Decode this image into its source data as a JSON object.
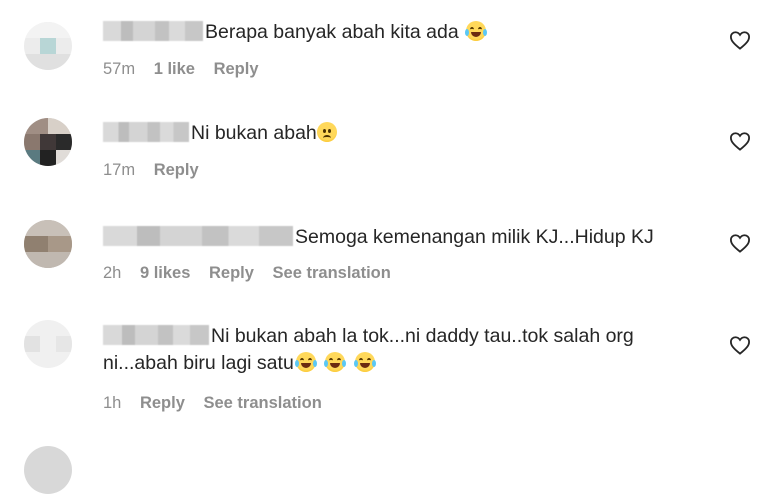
{
  "comments": [
    {
      "text": "Berapa banyak abah kita ada",
      "emoji": "joy-emoji",
      "time": "57m",
      "likes": "1 like",
      "reply": "Reply",
      "translation": ""
    },
    {
      "text": "Ni bukan abah",
      "emoji": "sad-emoji",
      "time": "17m",
      "likes": "",
      "reply": "Reply",
      "translation": ""
    },
    {
      "text": "Semoga kemenangan milik KJ...Hidup KJ",
      "emoji": "",
      "time": "2h",
      "likes": "9 likes",
      "reply": "Reply",
      "translation": "See translation"
    },
    {
      "text_line1": "Ni bukan abah la tok...ni daddy tau..tok salah org",
      "text_line2": "ni...abah biru lagi satu",
      "emoji": "joy-emoji x3",
      "time": "1h",
      "likes": "",
      "reply": "Reply",
      "translation": "See translation"
    }
  ],
  "icons": {
    "like": "heart-outline-icon"
  },
  "colors": {
    "text": "#262626",
    "meta": "#8e8e8e",
    "background": "#ffffff"
  }
}
